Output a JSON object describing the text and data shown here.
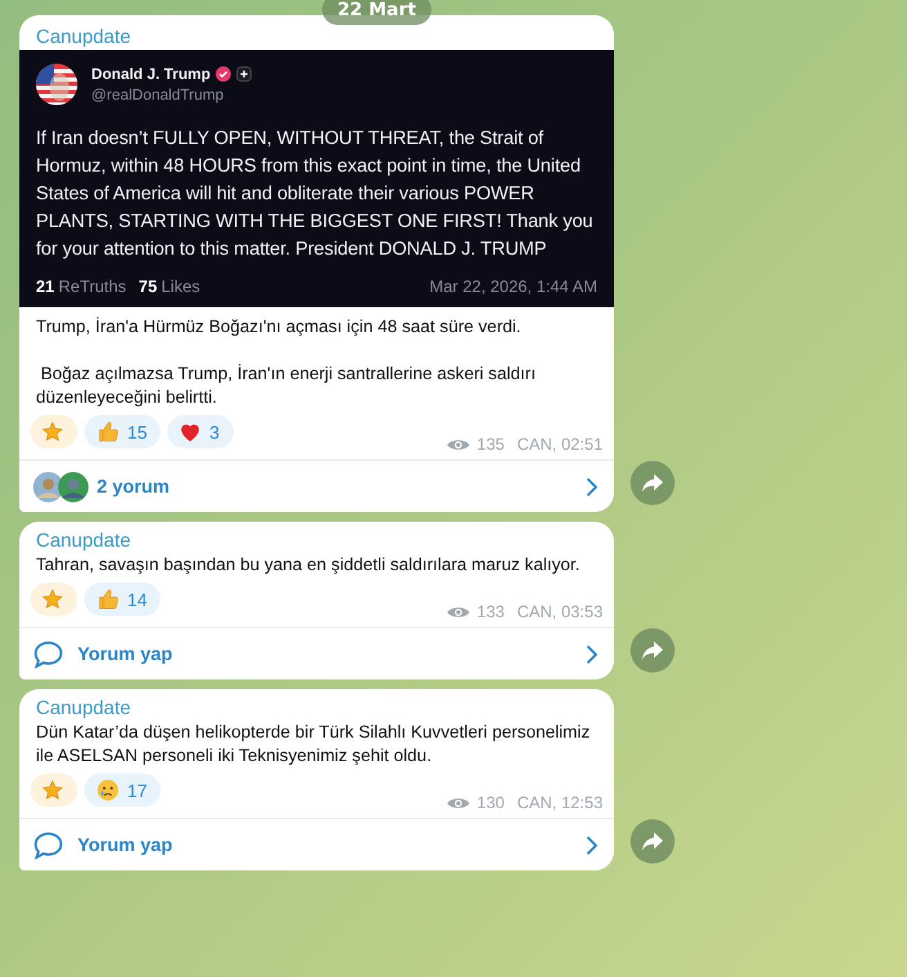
{
  "date": "22 Mart",
  "messages": [
    {
      "channel": "Canupdate",
      "embed": {
        "author": "Donald J. Trump",
        "handle": "@realDonaldTrump",
        "text": "If Iran doesn’t FULLY OPEN, WITHOUT THREAT, the Strait of Hormuz, within 48 HOURS from this exact point in time, the United States of America will hit and obliterate their various POWER PLANTS, STARTING WITH THE BIGGEST ONE FIRST! Thank you for your attention to this matter. President DONALD J. TRUMP",
        "retruths_count": "21",
        "retruths_label": "ReTruths",
        "likes_count": "75",
        "likes_label": "Likes",
        "date": "Mar 22, 2026, 1:44 AM"
      },
      "text": "Trump, İran'a Hürmüz Boğazı'nı açması için 48 saat süre verdi.\n\n Boğaz açılmazsa Trump, İran'ın enerji santrallerine askeri saldırı düzenleyeceğini belirtti.",
      "reactions": [
        {
          "kind": "star"
        },
        {
          "kind": "like",
          "count": "15"
        },
        {
          "kind": "heart",
          "count": "3"
        }
      ],
      "views": "135",
      "time": "CAN, 02:51",
      "comments": {
        "kind": "avatars",
        "label": "2 yorum"
      }
    },
    {
      "channel": "Canupdate",
      "text": "Tahran, savaşın başından bu yana en şiddetli saldırılara maruz kalıyor.",
      "reactions": [
        {
          "kind": "star"
        },
        {
          "kind": "like",
          "count": "14"
        }
      ],
      "views": "133",
      "time": "CAN, 03:53",
      "comments": {
        "kind": "prompt",
        "label": "Yorum yap"
      }
    },
    {
      "channel": "Canupdate",
      "text": "Dün Katar’da düşen helikopterde bir Türk Silahlı Kuvvetleri personelimiz ile ASELSAN personeli iki Teknisyenimiz şehit oldu.",
      "reactions": [
        {
          "kind": "star"
        },
        {
          "kind": "cry",
          "count": "17"
        }
      ],
      "views": "130",
      "time": "CAN, 12:53",
      "comments": {
        "kind": "prompt",
        "label": "Yorum yap"
      }
    }
  ]
}
